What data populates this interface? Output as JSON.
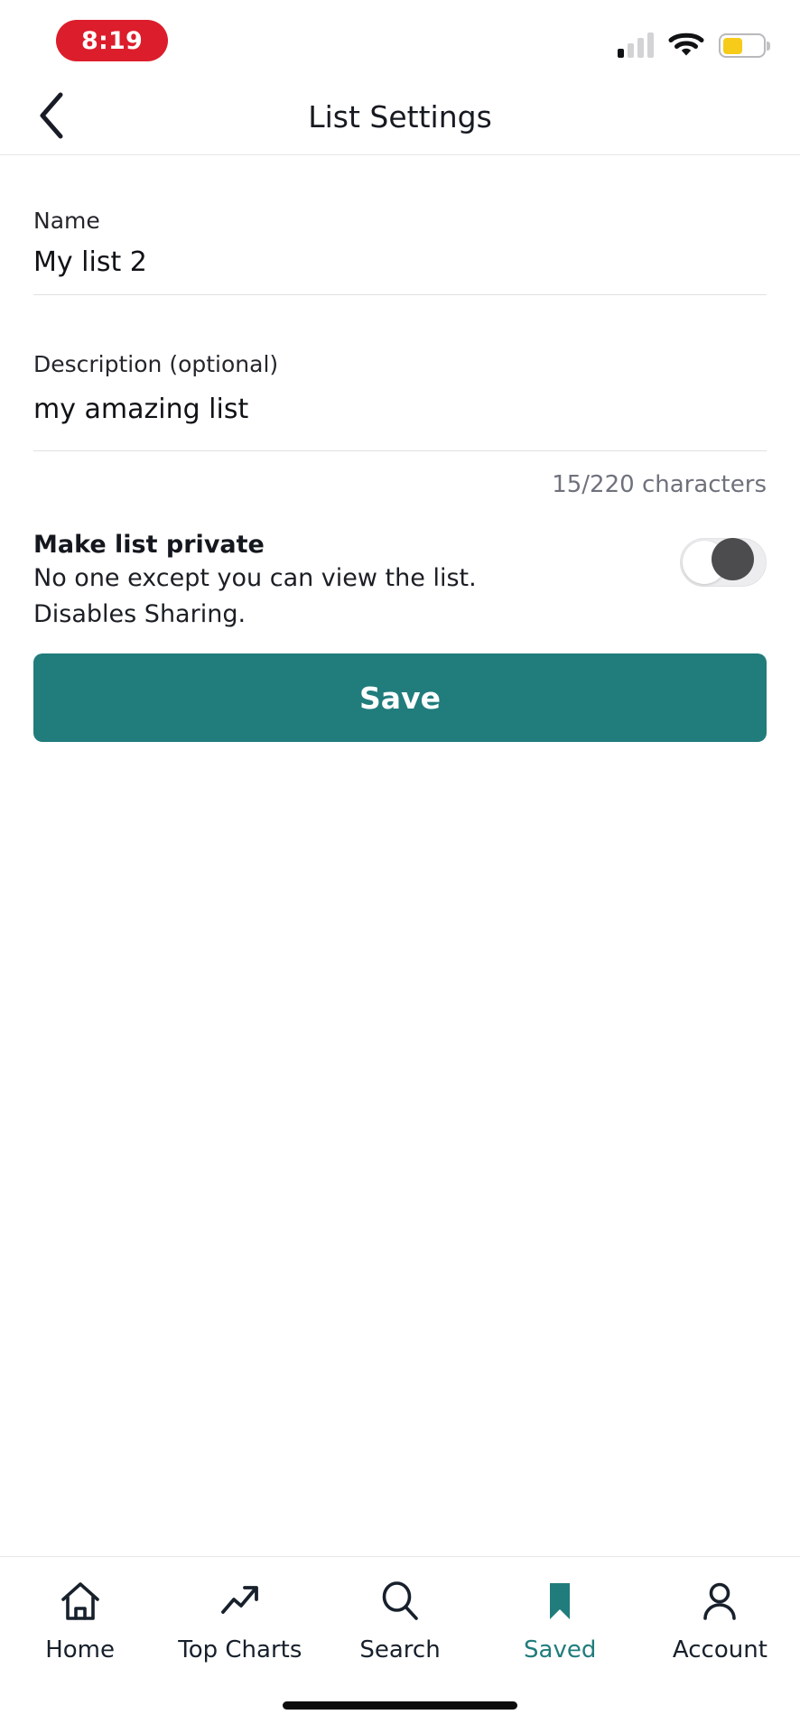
{
  "status_bar": {
    "time": "8:19",
    "time_pill_color": "#DC1D2C",
    "signal_icon": "cellular-signal-icon",
    "signal_bars_total": 4,
    "signal_bars_active": 1,
    "wifi_icon": "wifi-icon",
    "battery_icon": "battery-icon",
    "battery_level_percent": 50,
    "battery_color": "#F6CB19"
  },
  "header": {
    "back_icon": "chevron-left-icon",
    "title": "List Settings"
  },
  "form": {
    "name": {
      "label": "Name",
      "value": "My list 2",
      "placeholder": "Name"
    },
    "description": {
      "label": "Description (optional)",
      "value": "my amazing list",
      "placeholder": "Description (optional)",
      "counter": "15/220 characters",
      "used": 15,
      "max": 220
    },
    "private_toggle": {
      "title": "Make list private",
      "description_line_1": "No one except you can view the list.",
      "description_line_2": "Disables Sharing.",
      "state": "off"
    },
    "save": {
      "label": "Save",
      "color": "#217C7C"
    }
  },
  "tabbar": {
    "accent_color": "#217C7C",
    "active_index": 3,
    "items": [
      {
        "label": "Home",
        "icon": "home-icon"
      },
      {
        "label": "Top Charts",
        "icon": "trending-up-icon"
      },
      {
        "label": "Search",
        "icon": "search-icon"
      },
      {
        "label": "Saved",
        "icon": "bookmark-icon"
      },
      {
        "label": "Account",
        "icon": "person-icon"
      }
    ]
  }
}
